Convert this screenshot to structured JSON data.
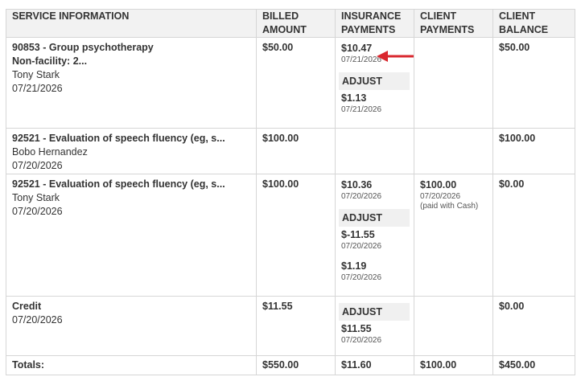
{
  "headers": {
    "service": "SERVICE INFORMATION",
    "billed": "BILLED AMOUNT",
    "insurance": "INSURANCE PAYMENTS",
    "client_payments": "CLIENT PAYMENTS",
    "client_balance": "CLIENT BALANCE"
  },
  "adjust_label": "ADJUST",
  "rows": [
    {
      "title": "90853 - Group psychotherapy",
      "subtitle": "Non-facility: 2...",
      "client": "Tony Stark",
      "date": "07/21/2026",
      "billed": "$50.00",
      "ins_amount": "$10.47",
      "ins_date": "07/21/2026",
      "adjustments": [
        {
          "amount": "$1.13",
          "date": "07/21/2026"
        }
      ],
      "client_payment": "",
      "balance": "$50.00"
    },
    {
      "title": "92521 - Evaluation of speech fluency (eg, s...",
      "client": "Bobo Hernandez",
      "date": "07/20/2026",
      "billed": "$100.00",
      "balance": "$100.00"
    },
    {
      "title": "92521 - Evaluation of speech fluency (eg, s...",
      "client": "Tony Stark",
      "date": "07/20/2026",
      "billed": "$100.00",
      "ins_amount": "$10.36",
      "ins_date": "07/20/2026",
      "adjustments": [
        {
          "amount": "$-11.55",
          "date": "07/20/2026"
        },
        {
          "amount": "$1.19",
          "date": "07/20/2026"
        }
      ],
      "client_payment": "$100.00",
      "client_payment_date": "07/20/2026",
      "client_payment_note": "(paid with Cash)",
      "balance": "$0.00"
    },
    {
      "title": "Credit",
      "date": "07/20/2026",
      "billed": "$11.55",
      "adjustments": [
        {
          "amount": "$11.55",
          "date": "07/20/2026"
        }
      ],
      "balance": "$0.00"
    }
  ],
  "totals": {
    "label": "Totals:",
    "billed": "$550.00",
    "insurance": "$11.60",
    "client_payments": "$100.00",
    "balance": "$450.00"
  },
  "colors": {
    "arrow": "#d9272e",
    "header_bg": "#f2f2f2",
    "border": "#d6d6d6"
  }
}
